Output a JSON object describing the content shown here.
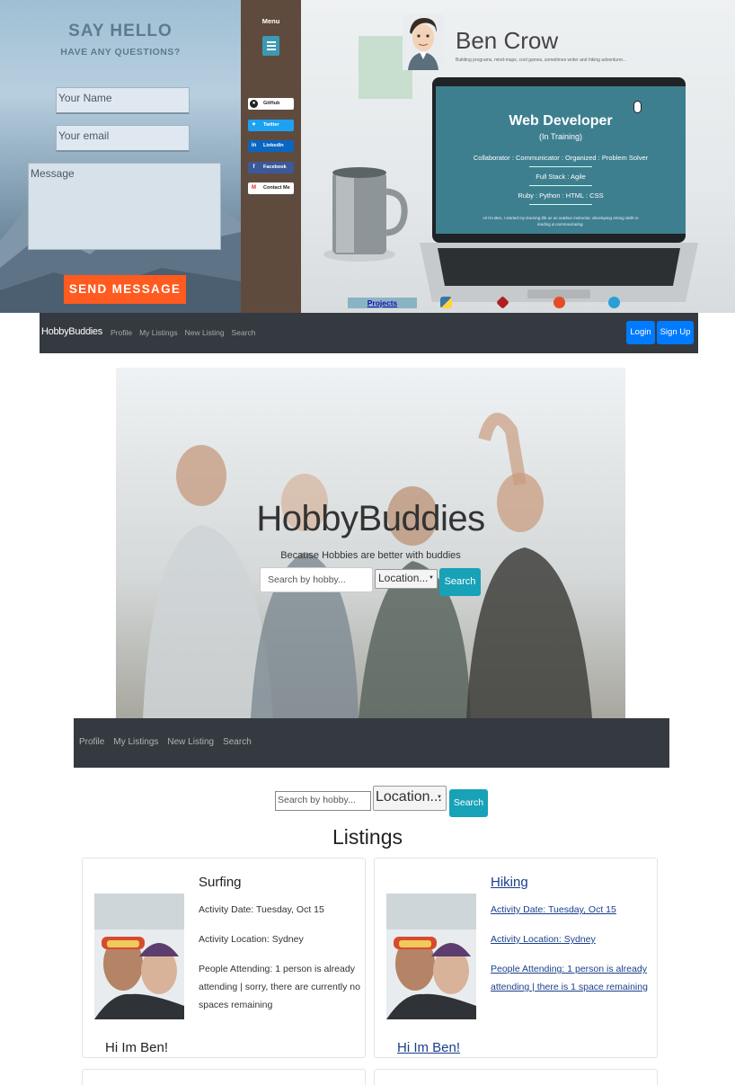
{
  "contact": {
    "title": "SAY HELLO",
    "subtitle": "HAVE ANY QUESTIONS?",
    "name_placeholder": "Your Name",
    "email_placeholder": "Your email",
    "message_placeholder": "Message",
    "send_label": "SEND MESSAGE"
  },
  "social": {
    "menu_label": "Menu",
    "buttons": [
      {
        "label": "GitHub",
        "icon": "github-icon"
      },
      {
        "label": "Twitter",
        "icon": "twitter-icon"
      },
      {
        "label": "LinkedIn",
        "icon": "linkedin-icon"
      },
      {
        "label": "Facebook",
        "icon": "facebook-icon"
      },
      {
        "label": "Contact Me",
        "icon": "gmail-icon"
      }
    ]
  },
  "portfolio": {
    "name": "Ben Crow",
    "tagline": "Building programs, mind-maps, cool games, sometimes writer and hiking adventurer...",
    "screen_title": "Web Developer",
    "screen_subtitle": "(In Training)",
    "traits": "Collaborator : Communicator : Organized : Problem Solver",
    "stack": "Full Stack : Agile",
    "langs": "Ruby : Python : HTML : CSS",
    "intro_1": "Hi I'm Ben, I started my learning life as an outdoor instructor, developing strong skills in",
    "intro_2": "leading & communicating.",
    "projects_label": "Projects"
  },
  "nav1": {
    "brand": "HobbyBuddies",
    "links": [
      "Profile",
      "My Listings",
      "New Listing",
      "Search"
    ],
    "login_label": "Login",
    "signup_label": "Sign Up"
  },
  "hero": {
    "title": "HobbyBuddies",
    "subtitle": "Because Hobbies are better with buddies",
    "search_placeholder": "Search by hobby...",
    "location_value": "Location...",
    "search_button": "Search"
  },
  "nav2": {
    "links": [
      "Profile",
      "My Listings",
      "New Listing",
      "Search"
    ]
  },
  "search2": {
    "search_placeholder": "Search by hobby...",
    "location_value": "Location...",
    "search_button": "Search"
  },
  "listings": {
    "title": "Listings",
    "cards": [
      {
        "title": "Surfing",
        "date": "Activity Date: Tuesday, Oct 15",
        "location": "Activity Location: Sydney",
        "attending": "People Attending: 1 person is already attending | sorry, there are currently no spaces remaining",
        "greeting": "Hi Im Ben!"
      },
      {
        "title": "Hiking",
        "date": "Activity Date: Tuesday, Oct 15",
        "location": "Activity Location: Sydney",
        "attending": "People Attending: 1 person is already attending | there is 1 space remaining",
        "greeting": "Hi Im Ben!"
      }
    ]
  },
  "colors": {
    "send_button": "#ff5a1f",
    "navbar": "#343a40",
    "primary": "#007bff",
    "info": "#17a2b8",
    "sidebar": "#5f4b3e"
  }
}
